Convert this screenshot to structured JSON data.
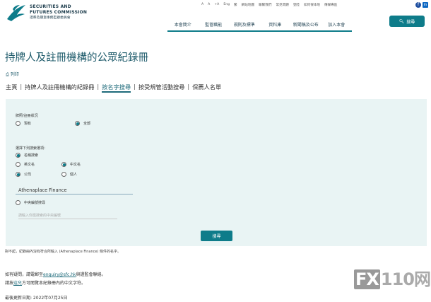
{
  "header": {
    "logo_en_1": "SECURITIES AND",
    "logo_en_2": "FUTURES COMMISSION",
    "logo_zh": "證券及期貨事務監察委員會",
    "utility": [
      "A",
      "A",
      "+A",
      "Eng",
      "繁",
      "網站地圖",
      "聯繫我們",
      "常見問題",
      "登陸",
      "如何保本地",
      "傳媒專區"
    ],
    "nav": [
      "本會簡介",
      "監管職能",
      "規則及標準",
      "資料庫",
      "新聞稿及公布",
      "加入本會"
    ],
    "search_label": "搜尋"
  },
  "page": {
    "title": "持牌人及註冊機構的公眾紀錄冊",
    "print_label": "列印",
    "tabs": [
      "主頁",
      "持牌人及註冊機構的紀錄冊",
      "按名字搜尋",
      "按受規管活動搜尋",
      "保薦人名單"
    ],
    "active_tab": "按名字搜尋"
  },
  "form": {
    "status_label": "牌照/註冊狀況",
    "status_options": [
      {
        "label": "現有",
        "selected": false
      },
      {
        "label": "全部",
        "selected": true
      }
    ],
    "choose_label": "選擇下列搜索選項：",
    "option_name_search": "名稱搜索",
    "option_english": "英文名",
    "option_chinese": "中文名",
    "option_company": "公司",
    "option_individual": "個人",
    "name_value": "Athenaplace Finance",
    "option_central_number": "中央編號搜尋",
    "central_placeholder": "請輸入你需搜索的中央編號",
    "submit_label": "搜尋"
  },
  "footer": {
    "note": "對不起，紀錄冊內沒有符合所輸入 (Athenaplace Finance) 條件的名字。",
    "contact_prefix": "如有疑問，請電郵至",
    "contact_email": "enquiry@sfc.hk",
    "contact_suffix": "與證監會聯絡。",
    "view_prefix": "請按",
    "view_link": "這兒",
    "view_suffix": "方可閱覽本紀錄冊內的中文字符。",
    "updated": "最後更新日期: 2022年07月25日"
  },
  "watermark": {
    "box": "FX",
    "text": "110网"
  },
  "colors": {
    "accent": "#0e7c8a",
    "panel": "#e9f4f4",
    "title": "#1d5a6a"
  }
}
